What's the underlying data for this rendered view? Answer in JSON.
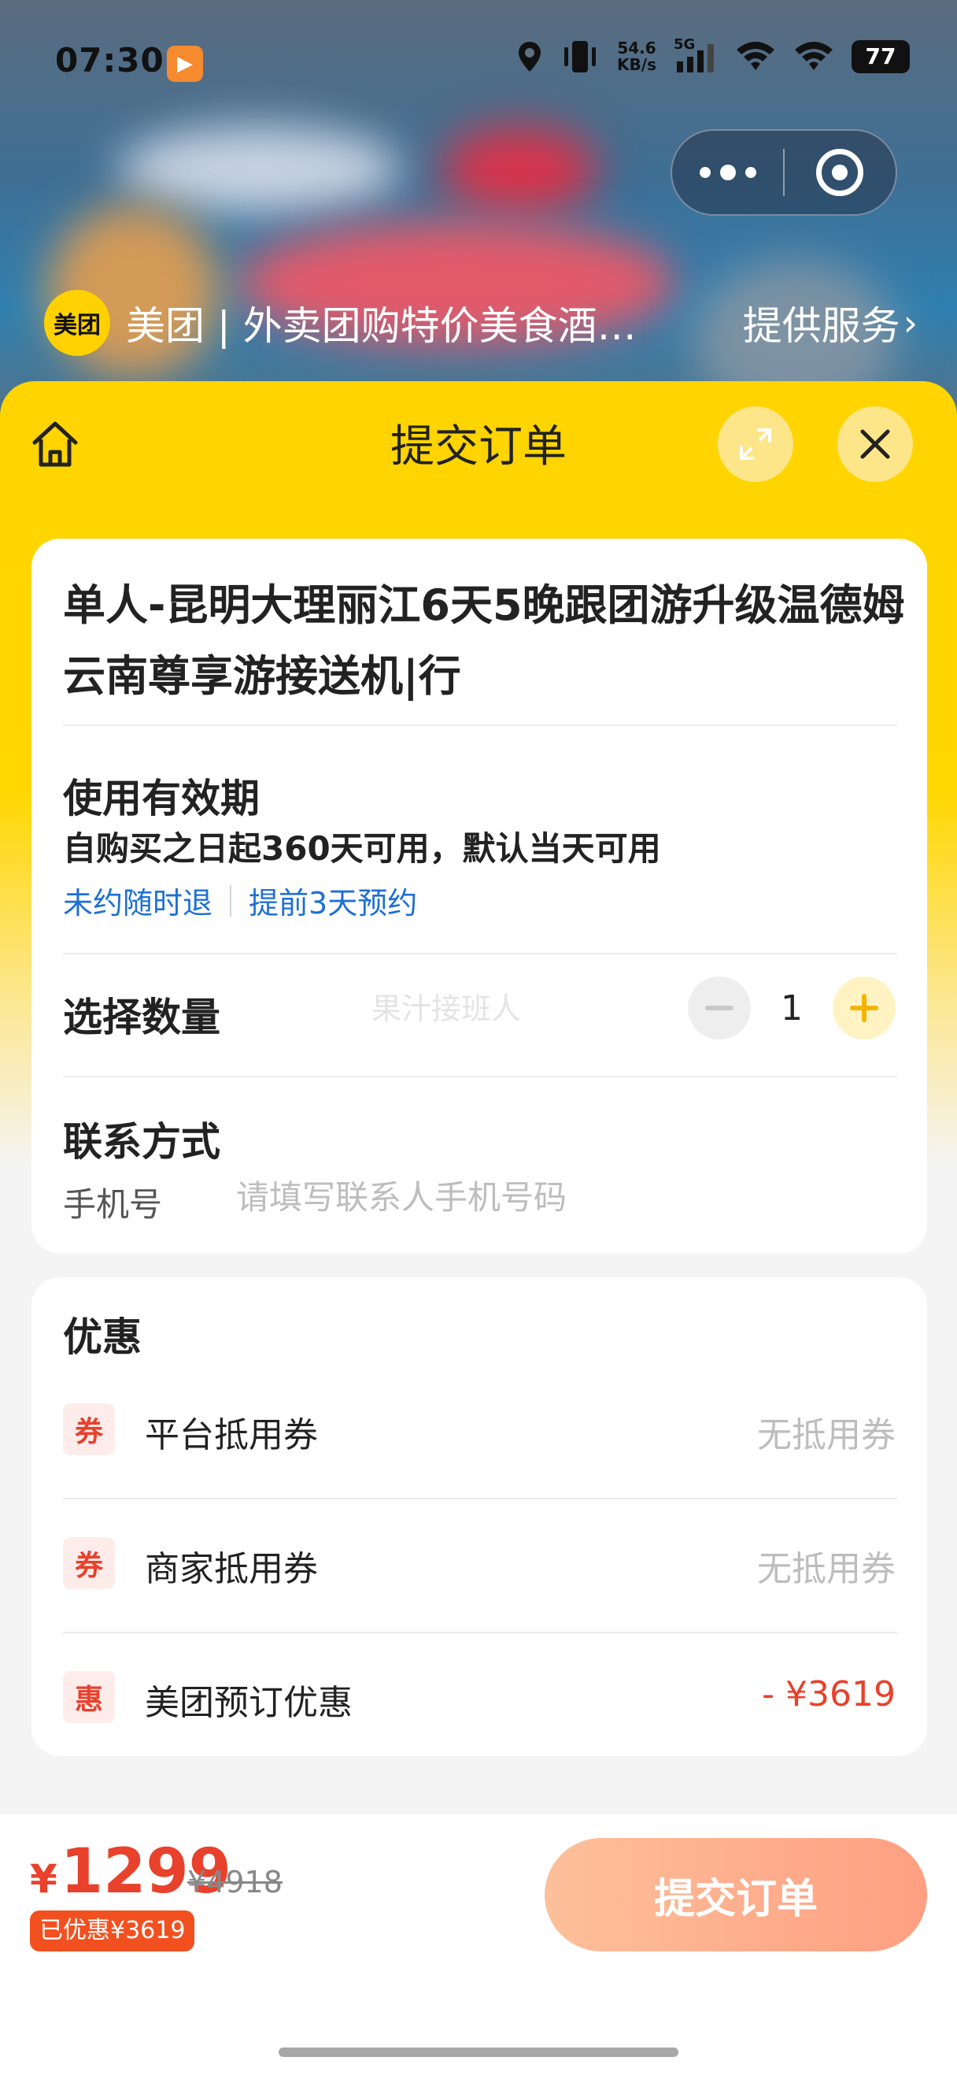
{
  "status_bar": {
    "time": "07:30",
    "net_speed_value": "54.6",
    "net_speed_unit": "KB/s",
    "network": "5G",
    "battery": "77"
  },
  "provider": {
    "logo_text": "美团",
    "name": "美团 | 外卖团购特价美食酒…",
    "service_label": "提供服务"
  },
  "sheet": {
    "title": "提交订单"
  },
  "product": {
    "title": "单人-昆明大理丽江6天5晚跟团游升级温德姆云南尊享游接送机|行"
  },
  "validity": {
    "label": "使用有效期",
    "text": "自购买之日起360天可用，默认当天可用",
    "tags": [
      "未约随时退",
      "提前3天预约"
    ]
  },
  "quantity": {
    "label": "选择数量",
    "watermark": "果汁接班人",
    "value": "1"
  },
  "contact": {
    "label": "联系方式",
    "phone_label": "手机号",
    "phone_value": "",
    "phone_placeholder": "请填写联系人手机号码"
  },
  "discounts": {
    "title": "优惠",
    "rows": [
      {
        "badge": "券",
        "label": "平台抵用券",
        "value": "无抵用券"
      },
      {
        "badge": "券",
        "label": "商家抵用券",
        "value": "无抵用券"
      },
      {
        "badge": "惠",
        "label": "美团预订优惠",
        "value": "- ¥3619"
      }
    ]
  },
  "footer": {
    "currency": "¥",
    "price": "1299",
    "original_price": "¥4918",
    "saved": "已优惠¥3619",
    "submit_label": "提交订单"
  },
  "colors": {
    "brand_yellow": "#ffd400",
    "price_red": "#e8412c",
    "link_blue": "#1d6fd6",
    "submit_gradient_start": "#fdc09a",
    "submit_gradient_end": "#ff9f82"
  }
}
